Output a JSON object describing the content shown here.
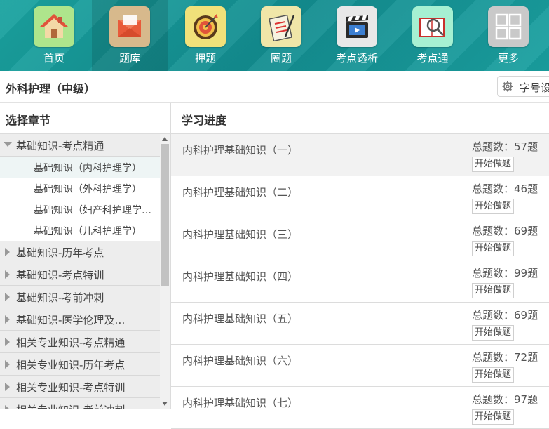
{
  "nav": [
    {
      "label": "首页",
      "icon": "home-icon",
      "bg": "#aee58c"
    },
    {
      "label": "题库",
      "icon": "envelope-icon",
      "bg": "#d7b98c"
    },
    {
      "label": "押题",
      "icon": "target-icon",
      "bg": "#f1e17a"
    },
    {
      "label": "圈题",
      "icon": "clipboard-icon",
      "bg": "#f0e6a8"
    },
    {
      "label": "考点透析",
      "icon": "film-clapper-icon",
      "bg": "#e8e8e8"
    },
    {
      "label": "考点通",
      "icon": "book-magnifier-icon",
      "bg": "#a6f0d2"
    },
    {
      "label": "更多",
      "icon": "grid-icon",
      "bg": "#c9c9c9"
    }
  ],
  "header": {
    "course_title": "外科护理（中级）",
    "font_size_label": "字号设置"
  },
  "left": {
    "title": "选择章节",
    "nodes": [
      {
        "label": "基础知识-考点精通",
        "expanded": true
      },
      {
        "label": "基础知识-历年考点"
      },
      {
        "label": "基础知识-考点特训"
      },
      {
        "label": "基础知识-考前冲刺"
      },
      {
        "label": "基础知识-医学伦理及…"
      },
      {
        "label": "相关专业知识-考点精通"
      },
      {
        "label": "相关专业知识-历年考点"
      },
      {
        "label": "相关专业知识-考点特训"
      },
      {
        "label": "相关专业知识-考前冲刺"
      }
    ],
    "subitems": [
      {
        "label": "基础知识（内科护理学）"
      },
      {
        "label": "基础知识（外科护理学）"
      },
      {
        "label": "基础知识（妇产科护理学…"
      },
      {
        "label": "基础知识（儿科护理学）"
      }
    ]
  },
  "right": {
    "title": "学习进度",
    "rows": [
      {
        "name": "内科护理基础知识（一）",
        "count": "总题数：57题",
        "button": "开始做题"
      },
      {
        "name": "内科护理基础知识（二）",
        "count": "总题数：46题",
        "button": "开始做题"
      },
      {
        "name": "内科护理基础知识（三）",
        "count": "总题数：69题",
        "button": "开始做题"
      },
      {
        "name": "内科护理基础知识（四）",
        "count": "总题数：99题",
        "button": "开始做题"
      },
      {
        "name": "内科护理基础知识（五）",
        "count": "总题数：69题",
        "button": "开始做题"
      },
      {
        "name": "内科护理基础知识（六）",
        "count": "总题数：72题",
        "button": "开始做题"
      },
      {
        "name": "内科护理基础知识（七）",
        "count": "总题数：97题",
        "button": "开始做题"
      }
    ]
  }
}
